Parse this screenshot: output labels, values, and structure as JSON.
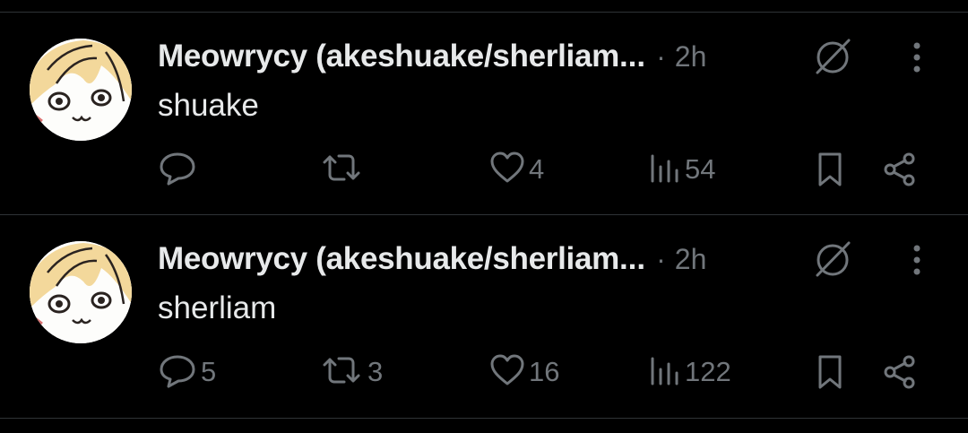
{
  "posts": [
    {
      "author": "Meowrycy (akeshuake/sherliam",
      "ellipsis": "...",
      "separator": "·",
      "time": "2h",
      "text": "shuake",
      "replies": "",
      "reposts": "",
      "likes": "4",
      "views": "54"
    },
    {
      "author": "Meowrycy (akeshuake/sherliam",
      "ellipsis": "...",
      "separator": "·",
      "time": "2h",
      "text": "sherliam",
      "replies": "5",
      "reposts": "3",
      "likes": "16",
      "views": "122"
    }
  ],
  "icons": {
    "mute": "circle-slash-icon",
    "more": "vertical-dots-icon",
    "reply": "speech-bubble-icon",
    "repost": "repost-arrows-icon",
    "like": "heart-icon",
    "views": "bar-chart-icon",
    "bookmark": "bookmark-icon",
    "share": "share-nodes-icon"
  },
  "colors": {
    "background": "#000000",
    "text": "#e7e9ea",
    "muted": "#71767b",
    "divider": "#2f3336"
  }
}
